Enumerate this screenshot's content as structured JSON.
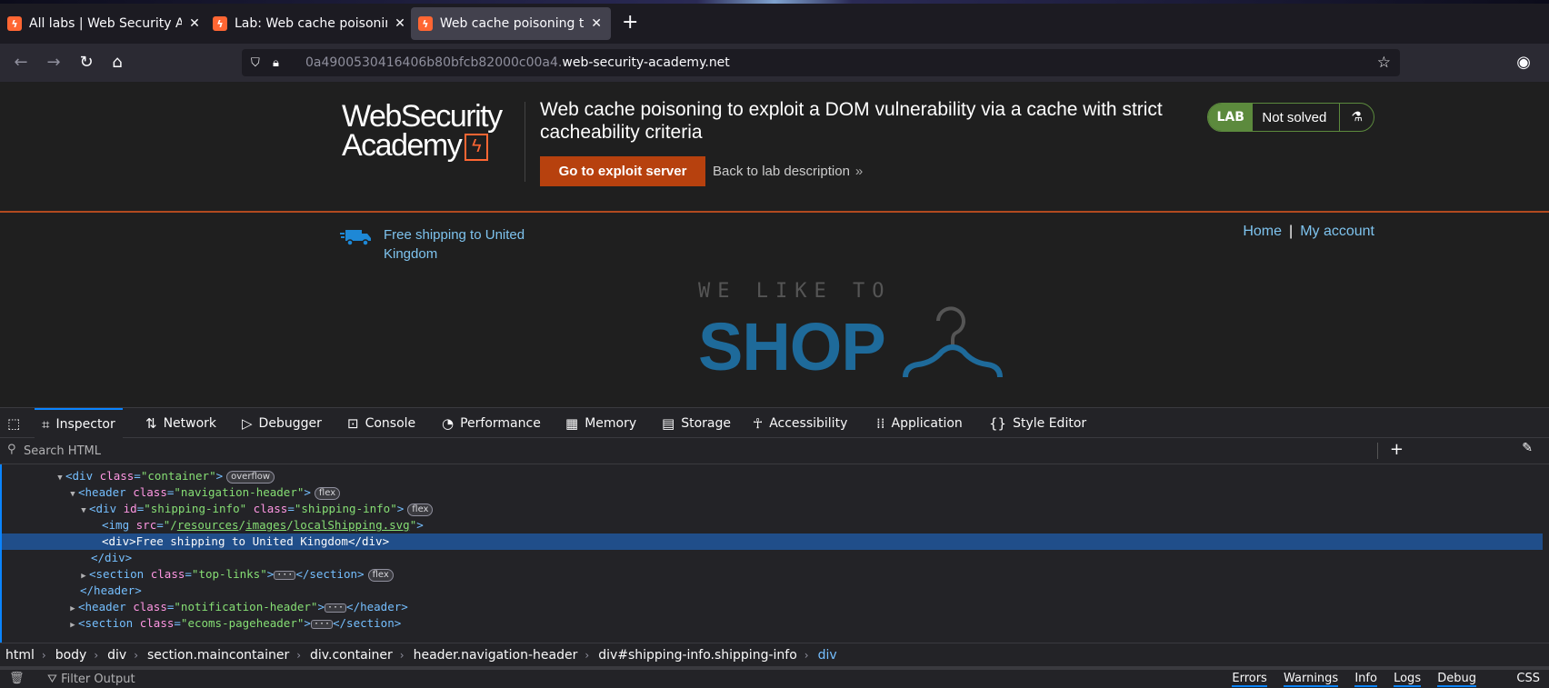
{
  "browser": {
    "tabs": [
      {
        "title": "All labs | Web Security Academy",
        "favicon": "burp-bolt-icon",
        "active": false
      },
      {
        "title": "Lab: Web cache poisoning to exploit a DOM vulnerability",
        "favicon": "burp-bolt-icon",
        "active": false
      },
      {
        "title": "Web cache poisoning to exploit a DOM vulnerability",
        "favicon": "burp-bolt-icon",
        "active": true
      }
    ],
    "new_tab": "+",
    "close_glyph": "✕",
    "url_prefix": "0a4900530416406b80bfcb82000c00a4.",
    "url_domain": "web-security-academy.net"
  },
  "lab_header": {
    "logo_line1": "WebSecurity",
    "logo_line2": "Academy",
    "title": "Web cache poisoning to exploit a DOM vulnerability via a cache with strict cacheability criteria",
    "exploit_button": "Go to exploit server",
    "back_link": "Back to lab description",
    "back_chevron": "»",
    "status_badge": "LAB",
    "status_text": "Not solved",
    "accent": "#ff6633",
    "status_color": "#5c8a3d"
  },
  "shop": {
    "shipping_text": "Free shipping to United Kingdom",
    "links": {
      "home": "Home",
      "separator": "|",
      "account": "My account"
    },
    "logo_small": "WE LIKE TO",
    "logo_big": "SHOP",
    "link_color": "#7ec3ee"
  },
  "devtools": {
    "tabs": [
      {
        "label": "Inspector",
        "icon": "inspector-icon",
        "active": true
      },
      {
        "label": "Network",
        "icon": "network-icon"
      },
      {
        "label": "Debugger",
        "icon": "debugger-icon"
      },
      {
        "label": "Console",
        "icon": "console-icon"
      },
      {
        "label": "Performance",
        "icon": "performance-icon"
      },
      {
        "label": "Memory",
        "icon": "memory-icon"
      },
      {
        "label": "Storage",
        "icon": "storage-icon"
      },
      {
        "label": "Accessibility",
        "icon": "accessibility-icon"
      },
      {
        "label": "Application",
        "icon": "application-icon"
      },
      {
        "label": "Style Editor",
        "icon": "style-editor-icon"
      }
    ],
    "search_placeholder": "Search HTML",
    "tree": {
      "n0": {
        "tag": "div",
        "attr": "class",
        "val": "container",
        "badge": "overflow"
      },
      "n1": {
        "tag": "header",
        "attr": "class",
        "val": "navigation-header",
        "badge": "flex"
      },
      "n2": {
        "tag": "div",
        "attr1": "id",
        "val1": "shipping-info",
        "attr2": "class",
        "val2": "shipping-info",
        "badge": "flex"
      },
      "n3": {
        "tag": "img",
        "attr": "src",
        "val_pre": "/",
        "seg1": "resources",
        "slash": "/",
        "seg2": "images",
        "seg3": "localShipping.svg"
      },
      "n4": {
        "open": "<div>",
        "text": "Free shipping to United Kingdom",
        "close": "</div>"
      },
      "n5": {
        "close": "</div>"
      },
      "n6": {
        "tag": "section",
        "attr": "class",
        "val": "top-links",
        "close": "</section>",
        "badge": "flex"
      },
      "n7": {
        "close": "</header>"
      },
      "n8": {
        "tag": "header",
        "attr": "class",
        "val": "notification-header",
        "close": "</header>"
      },
      "n9": {
        "tag": "section",
        "attr": "class",
        "val": "ecoms-pageheader",
        "close": "</section>"
      }
    },
    "breadcrumbs": [
      "html",
      "body",
      "div",
      "section.maincontainer",
      "div.container",
      "header.navigation-header",
      "div#shipping-info.shipping-info",
      "div"
    ],
    "console": {
      "filter_placeholder": "Filter Output",
      "levels": [
        "Errors",
        "Warnings",
        "Info",
        "Logs",
        "Debug"
      ],
      "css": "CSS"
    }
  }
}
